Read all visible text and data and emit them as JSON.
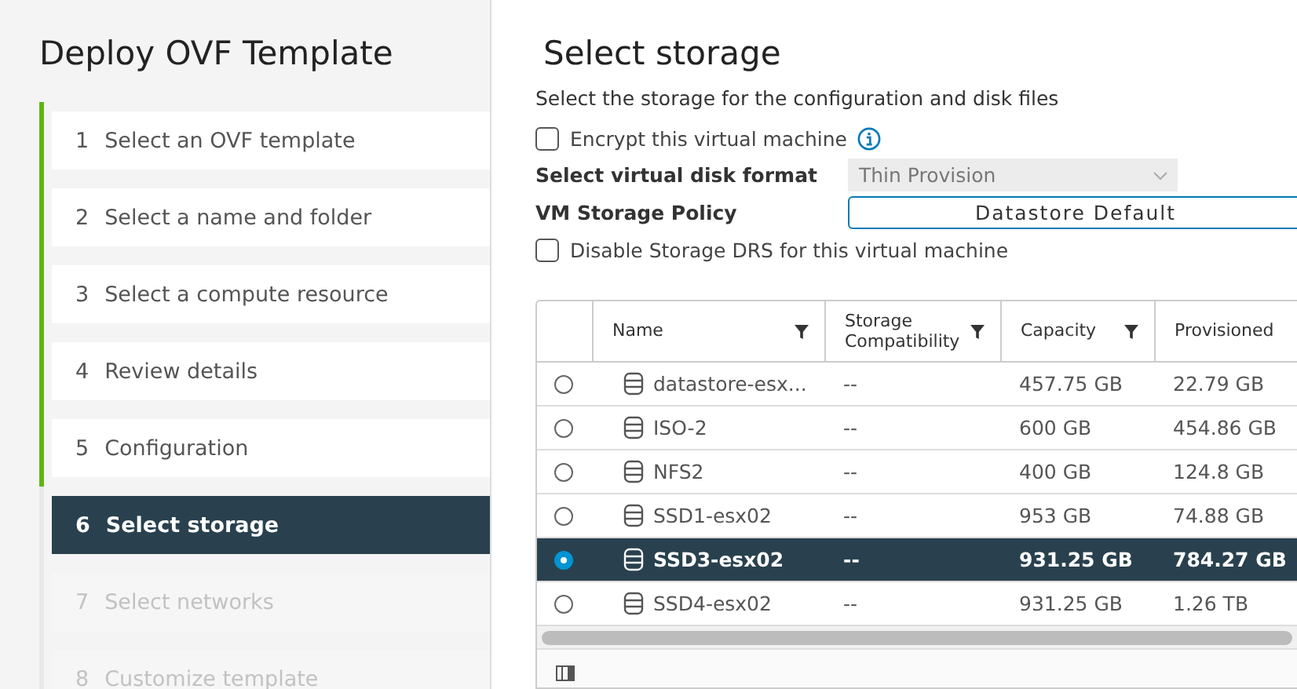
{
  "wizard": {
    "title": "Deploy OVF Template",
    "steps": [
      {
        "number": "1",
        "label": "Select an OVF template",
        "completed": true,
        "selected": false,
        "disabled": false
      },
      {
        "number": "2",
        "label": "Select a name and folder",
        "completed": true,
        "selected": false,
        "disabled": false
      },
      {
        "number": "3",
        "label": "Select a compute resource",
        "completed": true,
        "selected": false,
        "disabled": false
      },
      {
        "number": "4",
        "label": "Review details",
        "completed": true,
        "selected": false,
        "disabled": false
      },
      {
        "number": "5",
        "label": "Configuration",
        "completed": true,
        "selected": false,
        "disabled": false
      },
      {
        "number": "6",
        "label": "Select storage",
        "completed": false,
        "selected": true,
        "disabled": false
      },
      {
        "number": "7",
        "label": "Select networks",
        "completed": false,
        "selected": false,
        "disabled": true
      },
      {
        "number": "8",
        "label": "Customize template",
        "completed": false,
        "selected": false,
        "disabled": true
      }
    ]
  },
  "page": {
    "title": "Select storage",
    "description": "Select the storage for the configuration and disk files",
    "encrypt": {
      "label": "Encrypt this virtual machine",
      "checked": false
    },
    "disk_format": {
      "label": "Select virtual disk format",
      "value": "Thin Provision",
      "disabled": true
    },
    "storage_policy": {
      "label": "VM Storage Policy",
      "value": "Datastore Default"
    },
    "disable_drs": {
      "label": "Disable Storage DRS for this virtual machine",
      "checked": false
    }
  },
  "table": {
    "columns": [
      {
        "label": "Name",
        "filter": true
      },
      {
        "label": "Storage Compatibility",
        "filter": true
      },
      {
        "label": "Capacity",
        "filter": true
      },
      {
        "label": "Provisioned",
        "filter": false
      }
    ],
    "rows": [
      {
        "name": "datastore-esx...",
        "compatibility": "--",
        "capacity": "457.75 GB",
        "provisioned": "22.79 GB",
        "selected": false
      },
      {
        "name": "ISO-2",
        "compatibility": "--",
        "capacity": "600 GB",
        "provisioned": "454.86 GB",
        "selected": false
      },
      {
        "name": "NFS2",
        "compatibility": "--",
        "capacity": "400 GB",
        "provisioned": "124.8 GB",
        "selected": false
      },
      {
        "name": "SSD1-esx02",
        "compatibility": "--",
        "capacity": "953 GB",
        "provisioned": "74.88 GB",
        "selected": false
      },
      {
        "name": "SSD3-esx02",
        "compatibility": "--",
        "capacity": "931.25 GB",
        "provisioned": "784.27 GB",
        "selected": true
      },
      {
        "name": "SSD4-esx02",
        "compatibility": "--",
        "capacity": "931.25 GB",
        "provisioned": "1.26 TB",
        "selected": false
      }
    ]
  }
}
